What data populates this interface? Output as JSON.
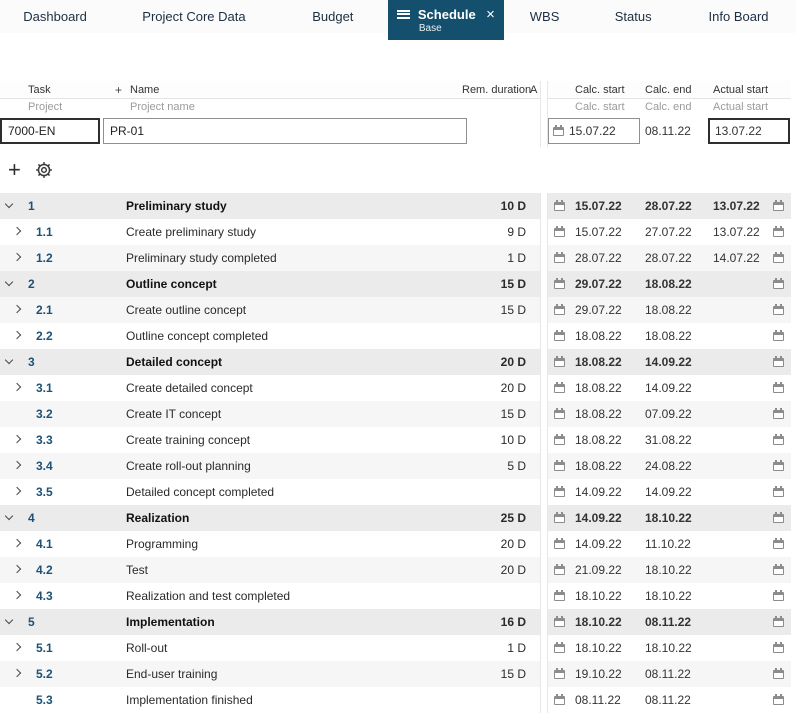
{
  "app": {
    "accent_color": "#14506e",
    "group_row_color": "#ebebeb"
  },
  "icons": {
    "close": "×",
    "menu": "hamburger-icon",
    "add": "+",
    "settings": "gear-icon",
    "calendar": "calendar-icon"
  },
  "tabs": [
    {
      "label": "Dashboard",
      "active": false
    },
    {
      "label": "Project Core Data",
      "active": false
    },
    {
      "label": "Budget",
      "active": false
    },
    {
      "label": "Schedule",
      "active": true,
      "sub": "Base"
    },
    {
      "label": "WBS",
      "active": false
    },
    {
      "label": "Status",
      "active": false
    },
    {
      "label": "Info Board",
      "active": false
    }
  ],
  "grid": {
    "columns": {
      "task": "Task",
      "name_add": "+",
      "name": "Name",
      "rem_duration": "Rem. duration",
      "a": "A",
      "calc_start": "Calc. start",
      "calc_end": "Calc. end",
      "actual_start": "Actual start"
    },
    "filters": {
      "project": "Project",
      "project_name": "Project name",
      "calc_start": "Calc. start",
      "calc_end": "Calc. end",
      "actual_start": "Actual start"
    },
    "project_row": {
      "id": "7000-EN",
      "name": "PR-01",
      "calc_start": "15.07.22",
      "calc_end": "08.11.22",
      "actual_start": "13.07.22"
    }
  },
  "toolbar": {
    "add": "+"
  },
  "rows": [
    {
      "num": "1",
      "name": "Preliminary study",
      "dur": "10 D",
      "cs": "15.07.22",
      "ce": "28.07.22",
      "as": "13.07.22",
      "group": true,
      "arrow": "down"
    },
    {
      "num": "1.1",
      "name": "Create preliminary study",
      "dur": "9 D",
      "cs": "15.07.22",
      "ce": "27.07.22",
      "as": "13.07.22",
      "group": false,
      "arrow": "right"
    },
    {
      "num": "1.2",
      "name": "Preliminary study completed",
      "dur": "1 D",
      "cs": "28.07.22",
      "ce": "28.07.22",
      "as": "14.07.22",
      "group": false,
      "arrow": "right"
    },
    {
      "num": "2",
      "name": "Outline concept",
      "dur": "15 D",
      "cs": "29.07.22",
      "ce": "18.08.22",
      "as": "",
      "group": true,
      "arrow": "down"
    },
    {
      "num": "2.1",
      "name": "Create outline concept",
      "dur": "15 D",
      "cs": "29.07.22",
      "ce": "18.08.22",
      "as": "",
      "group": false,
      "arrow": "right"
    },
    {
      "num": "2.2",
      "name": "Outline concept completed",
      "dur": "",
      "cs": "18.08.22",
      "ce": "18.08.22",
      "as": "",
      "group": false,
      "arrow": "right"
    },
    {
      "num": "3",
      "name": "Detailed concept",
      "dur": "20 D",
      "cs": "18.08.22",
      "ce": "14.09.22",
      "as": "",
      "group": true,
      "arrow": "down"
    },
    {
      "num": "3.1",
      "name": "Create detailed concept",
      "dur": "20 D",
      "cs": "18.08.22",
      "ce": "14.09.22",
      "as": "",
      "group": false,
      "arrow": "right"
    },
    {
      "num": "3.2",
      "name": "Create IT concept",
      "dur": "15 D",
      "cs": "18.08.22",
      "ce": "07.09.22",
      "as": "",
      "group": false,
      "arrow": "none"
    },
    {
      "num": "3.3",
      "name": "Create training concept",
      "dur": "10 D",
      "cs": "18.08.22",
      "ce": "31.08.22",
      "as": "",
      "group": false,
      "arrow": "right"
    },
    {
      "num": "3.4",
      "name": "Create roll-out planning",
      "dur": "5 D",
      "cs": "18.08.22",
      "ce": "24.08.22",
      "as": "",
      "group": false,
      "arrow": "right"
    },
    {
      "num": "3.5",
      "name": "Detailed concept completed",
      "dur": "",
      "cs": "14.09.22",
      "ce": "14.09.22",
      "as": "",
      "group": false,
      "arrow": "right"
    },
    {
      "num": "4",
      "name": "Realization",
      "dur": "25 D",
      "cs": "14.09.22",
      "ce": "18.10.22",
      "as": "",
      "group": true,
      "arrow": "down"
    },
    {
      "num": "4.1",
      "name": "Programming",
      "dur": "20 D",
      "cs": "14.09.22",
      "ce": "11.10.22",
      "as": "",
      "group": false,
      "arrow": "right"
    },
    {
      "num": "4.2",
      "name": "Test",
      "dur": "20 D",
      "cs": "21.09.22",
      "ce": "18.10.22",
      "as": "",
      "group": false,
      "arrow": "right"
    },
    {
      "num": "4.3",
      "name": "Realization and test completed",
      "dur": "",
      "cs": "18.10.22",
      "ce": "18.10.22",
      "as": "",
      "group": false,
      "arrow": "right"
    },
    {
      "num": "5",
      "name": "Implementation",
      "dur": "16 D",
      "cs": "18.10.22",
      "ce": "08.11.22",
      "as": "",
      "group": true,
      "arrow": "down"
    },
    {
      "num": "5.1",
      "name": "Roll-out",
      "dur": "1 D",
      "cs": "18.10.22",
      "ce": "18.10.22",
      "as": "",
      "group": false,
      "arrow": "right"
    },
    {
      "num": "5.2",
      "name": "End-user training",
      "dur": "15 D",
      "cs": "19.10.22",
      "ce": "08.11.22",
      "as": "",
      "group": false,
      "arrow": "right"
    },
    {
      "num": "5.3",
      "name": "Implementation finished",
      "dur": "",
      "cs": "08.11.22",
      "ce": "08.11.22",
      "as": "",
      "group": false,
      "arrow": "none"
    }
  ]
}
